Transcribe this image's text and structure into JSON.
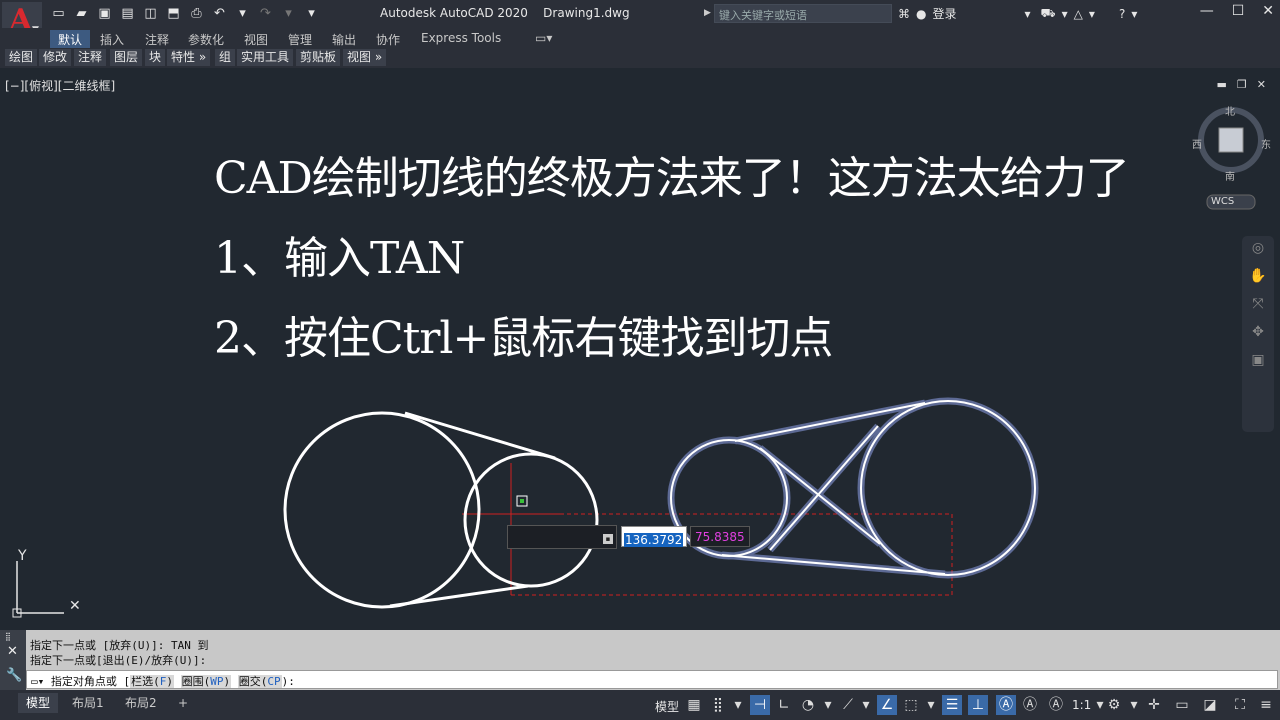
{
  "titlebar": {
    "title": "Autodesk AutoCAD 2020    Drawing1.dwg",
    "search_placeholder": "键入关键字或短语",
    "login": "登录",
    "logo_letter": "A"
  },
  "ribbon_tabs": [
    "默认",
    "插入",
    "注释",
    "参数化",
    "视图",
    "管理",
    "输出",
    "协作",
    "Express Tools"
  ],
  "panels": [
    "绘图",
    "修改",
    "注释",
    "图层",
    "块",
    "特性 »",
    "组",
    "实用工具",
    "剪贴板",
    "视图 »"
  ],
  "viewport": {
    "label": "[−][俯视][二维线框]",
    "line1": "CAD绘制切线的终极方法来了！这方法太给力了",
    "line2": "1、输入TAN",
    "line3": "2、按住Ctrl+鼠标右键找到切点",
    "compass": {
      "n": "北",
      "s": "南",
      "e": "东",
      "w": "西",
      "ucs": "WCS"
    },
    "ucs_y": "Y",
    "dyn_value1": "136.3792",
    "dyn_value2": "75.8385"
  },
  "command": {
    "line1": "指定下一点或 [放弃(U)]: TAN 到",
    "line2": "指定下一点或[退出(E)/放弃(U)]:",
    "prompt": "指定对角点或 [",
    "opt1": "栏选(",
    "opt1_key": "F",
    "opt2": "圈围(",
    "opt2_key": "WP",
    "opt3": "圈交(",
    "opt3_key": "CP",
    "tail": "):"
  },
  "status": {
    "tabs": [
      "模型",
      "布局1",
      "布局2"
    ],
    "add": "+",
    "model_label": "模型",
    "scale": "1:1"
  },
  "colors": {
    "background": "#212830",
    "accent": "#3a6aa8",
    "selection_glow": "#b8c4f0"
  }
}
